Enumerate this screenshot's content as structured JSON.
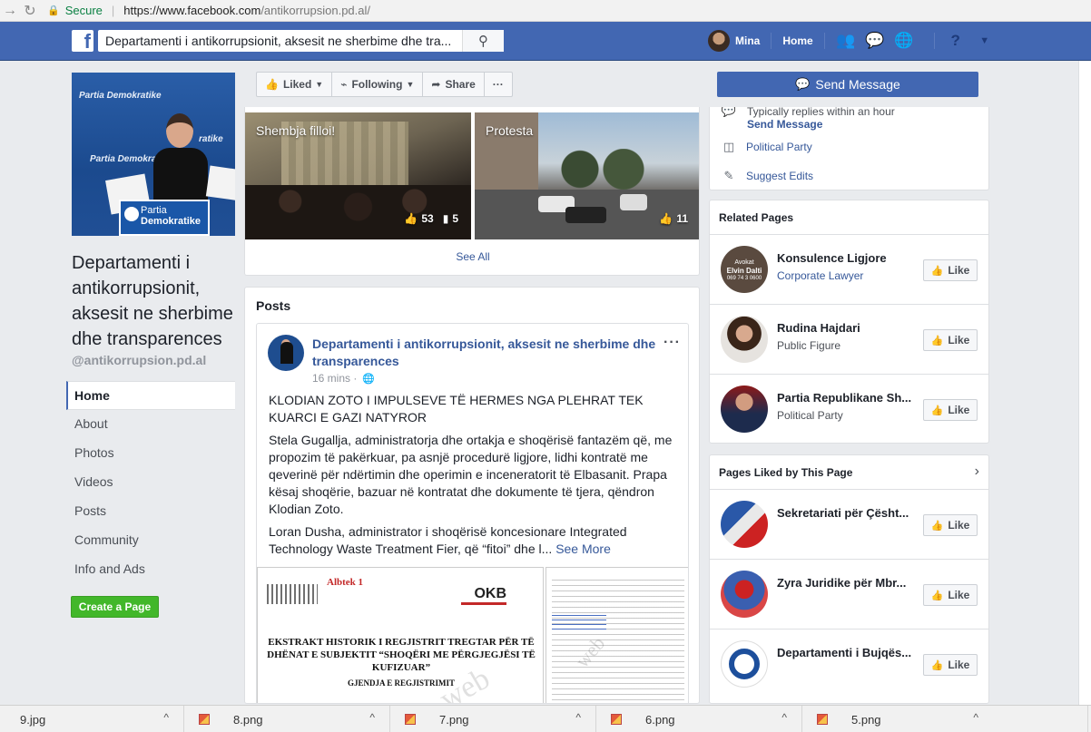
{
  "browser": {
    "secure_label": "Secure",
    "url_host": "https://www.facebook.com",
    "url_path": "/antikorrupsion.pd.al/"
  },
  "topbar": {
    "search_value": "Departamenti i antikorrupsionit, aksesit ne sherbime dhe tra...",
    "user_name": "Mina",
    "home_label": "Home"
  },
  "page": {
    "name": "Departamenti i antikorrupsionit, aksesit ne sherbime dhe transparences",
    "handle": "@antikorrupsion.pd.al",
    "pic_text_top": "Partia Demokratike",
    "pic_text_mid": "Partia Demokratike",
    "pic_text_right": "ratike",
    "pic_podium_1": "Partia",
    "pic_podium_2": "Demokratike"
  },
  "leftnav": {
    "items": [
      "Home",
      "About",
      "Photos",
      "Videos",
      "Posts",
      "Community",
      "Info and Ads"
    ],
    "create_page": "Create a Page"
  },
  "actionbar": {
    "liked": "Liked",
    "following": "Following",
    "share": "Share",
    "more": "···",
    "send_message": "Send Message"
  },
  "videos": {
    "items": [
      {
        "title": "Shembja filloi!",
        "likes": "53",
        "comments": "5"
      },
      {
        "title": "Protesta",
        "likes": "11"
      }
    ],
    "see_all": "See All"
  },
  "about": {
    "typically": "Typically replies within an hour",
    "send_message": "Send Message",
    "category": "Political Party",
    "suggest": "Suggest Edits"
  },
  "posts": {
    "title": "Posts",
    "author": "Departamenti i antikorrupsionit, aksesit ne sherbime dhe transparences",
    "time": "16 mins ·",
    "headline": "KLODIAN ZOTO I IMPULSEVE TË HERMES NGA PLEHRAT TEK KUARCI E GAZI NATYROR",
    "body": "Stela Gugallja, administratorja dhe ortakja e shoqërisë fantazëm që, me propozim të pakërkuar, pa asnjë procedurë ligjore, lidhi kontratë me qeverinë për ndërtimin dhe operimin e inceneratorit të Elbasanit. Prapa kësaj shoqërie, bazuar në kontratat dhe dokumente të tjera, qëndron Klodian Zoto.",
    "body2": "Loran Dusha, administrator i shoqërisë koncesionare Integrated Technology Waste Treatment Fier, që “fitoi” dhe l...",
    "see_more": "See More",
    "doc_albtek": "Albtek 1",
    "doc_okb": "OKB",
    "doc_title": "EKSTRAKT HISTORIK I REGJISTRIT TREGTAR PËR TË DHËNAT E SUBJEKTIT “SHOQËRI ME PËRGJEGJËSI TË KUFIZUAR”",
    "doc_sub": "GJENDJA E REGJISTRIMIT"
  },
  "related": {
    "title": "Related Pages",
    "items": [
      {
        "name": "Konsulence Ligjore",
        "category": "Corporate Lawyer",
        "like": "Like",
        "avatar_text_1": "Avokat",
        "avatar_text_2": "Elvin Dalti",
        "avatar_text_3": "069 74 3 0600"
      },
      {
        "name": "Rudina Hajdari",
        "category": "Public Figure",
        "like": "Like"
      },
      {
        "name": "Partia Republikane Sh...",
        "category": "Political Party",
        "like": "Like"
      }
    ]
  },
  "liked": {
    "title": "Pages Liked by This Page",
    "items": [
      {
        "name": "Sekretariati për Çësht...",
        "like": "Like"
      },
      {
        "name": "Zyra Juridike për Mbr...",
        "like": "Like"
      },
      {
        "name": "Departamenti i Bujqës...",
        "like": "Like"
      }
    ]
  },
  "downloads": [
    "9.jpg",
    "8.png",
    "7.png",
    "6.png",
    "5.png"
  ],
  "colors": {
    "fb_blue": "#4267b2",
    "link": "#365899",
    "green": "#42b72a"
  }
}
